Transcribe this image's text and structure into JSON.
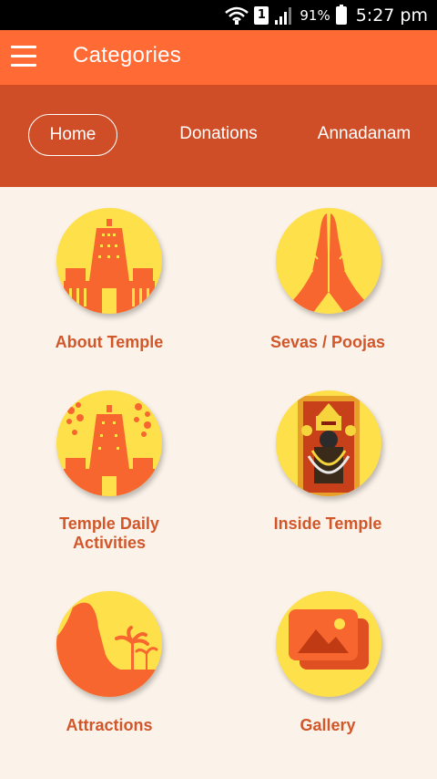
{
  "status_bar": {
    "sim_label": "1",
    "battery_percent": "91%",
    "time": "5:27 pm"
  },
  "app_bar": {
    "title": "Categories",
    "menu_icon": "hamburger-menu-icon"
  },
  "tabs": [
    {
      "label": "Home",
      "selected": true
    },
    {
      "label": "Donations",
      "selected": false
    },
    {
      "label": "Annadanam",
      "selected": false
    }
  ],
  "categories": [
    {
      "label": "About Temple",
      "icon": "temple-gopuram-icon"
    },
    {
      "label": "Sevas / Poojas",
      "icon": "praying-hands-icon"
    },
    {
      "label": "Temple Daily Activities",
      "icon": "temple-flowers-icon"
    },
    {
      "label": "Inside Temple",
      "icon": "deity-image-icon"
    },
    {
      "label": "Attractions",
      "icon": "hill-palm-icon"
    },
    {
      "label": "Gallery",
      "icon": "gallery-icon"
    }
  ],
  "colors": {
    "app_bar": "#ff6a35",
    "tab_bar": "#cf4e27",
    "background": "#fbf3ea",
    "icon_circle": "#fde04a",
    "icon_fg": "#f8662f",
    "label": "#d1572b"
  }
}
